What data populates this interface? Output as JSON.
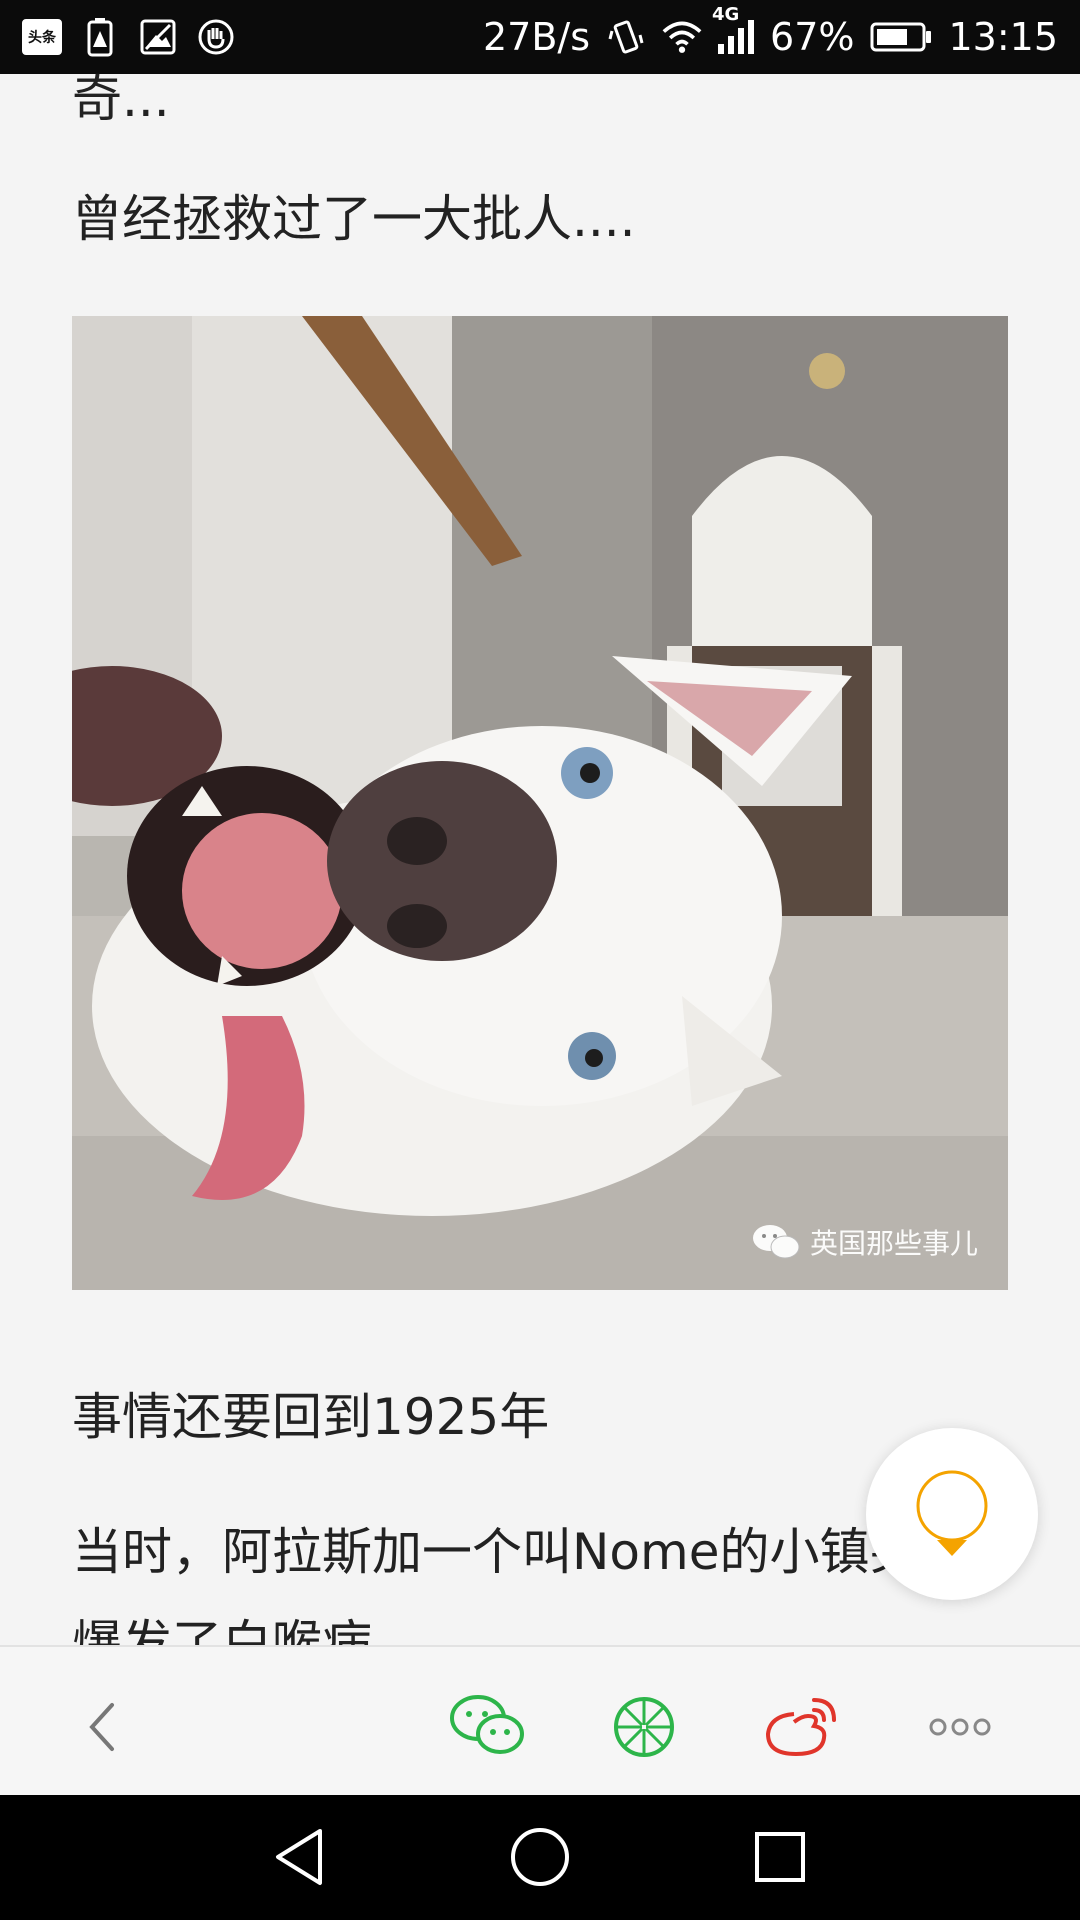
{
  "status_bar": {
    "app_icon_text": "头条",
    "net_speed": "27B/s",
    "network_type": "4G",
    "battery": "67%",
    "time": "13:15"
  },
  "article": {
    "cut_line": "奇...",
    "para1": "曾经拯救过了一大批人....",
    "image_watermark": "英国那些事儿",
    "para3": "事情还要回到1925年",
    "para4": "当时，阿拉斯加一个叫Nome的小镇突然爆发了白喉病."
  },
  "share_bar": {
    "icons": [
      "back-icon",
      "wechat-icon",
      "moments-icon",
      "weibo-icon",
      "more-icon"
    ],
    "wechat_color": "#2db54a",
    "weibo_color": "#e0352b"
  },
  "fab": {
    "icon": "lightbulb-icon",
    "color": "#f4a300"
  }
}
